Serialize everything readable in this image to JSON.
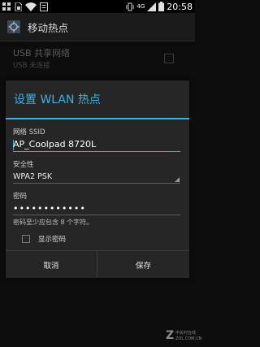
{
  "status_bar": {
    "network_label": "4G",
    "time": "20:58"
  },
  "action_bar": {
    "title": "移动热点"
  },
  "background_list": {
    "usb_title": "USB 共享网络",
    "usb_sub": "USB 未连接"
  },
  "dialog": {
    "title": "设置 WLAN 热点",
    "ssid_label": "网络 SSID",
    "ssid_value": "AP_Coolpad 8720L",
    "security_label": "安全性",
    "security_value": "WPA2 PSK",
    "password_label": "密码",
    "password_value": "••••••••••••",
    "password_hint": "密码至少应包含 8 个字符。",
    "show_password_label": "显示密码",
    "show_password_checked": false,
    "cancel_label": "取消",
    "save_label": "保存"
  },
  "colors": {
    "accent": "#34b3e4",
    "dialog_bg": "#262626",
    "screen_bg": "#0d0d0d"
  },
  "icons": [
    "app-grid-icon",
    "sim-icon",
    "wifi-icon",
    "notification-icon",
    "signal-icon",
    "battery-icon",
    "hotspot-settings-icon"
  ],
  "watermark": {
    "logo": "Z",
    "line1": "中关村在线",
    "line2": "ZOL.COM.CN"
  }
}
